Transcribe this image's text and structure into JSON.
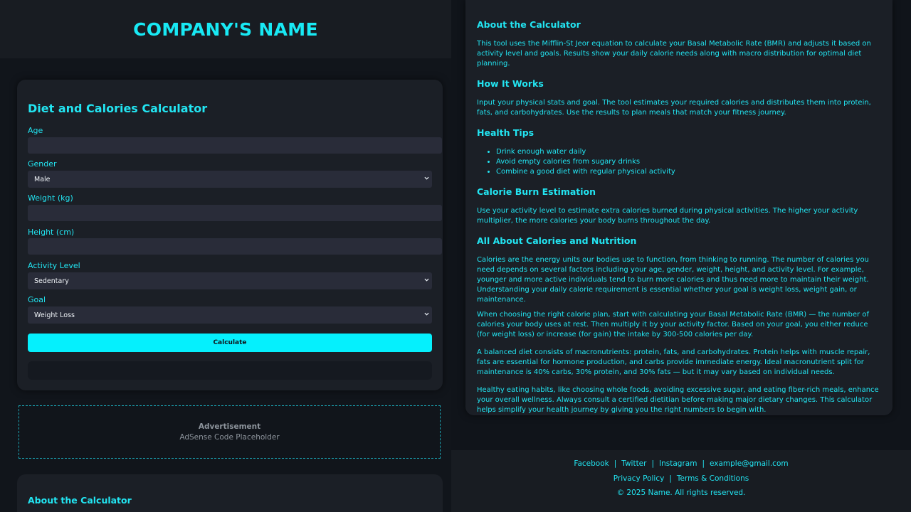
{
  "header": {
    "company_name": "COMPANY'S NAME"
  },
  "calculator": {
    "title": "Diet and Calories Calculator",
    "age_label": "Age",
    "age_value": "",
    "gender_label": "Gender",
    "gender_value": "Male",
    "weight_label": "Weight (kg)",
    "weight_value": "",
    "height_label": "Height (cm)",
    "height_value": "",
    "activity_label": "Activity Level",
    "activity_value": "Sedentary",
    "goal_label": "Goal",
    "goal_value": "Weight Loss",
    "calculate_label": "Calculate",
    "result_text": ""
  },
  "ad": {
    "title": "Advertisement",
    "placeholder": "AdSense Code Placeholder"
  },
  "about_left": {
    "title": "About the Calculator"
  },
  "info": {
    "about_title": "About the Calculator",
    "about_text": "This tool uses the Mifflin-St Jeor equation to calculate your Basal Metabolic Rate (BMR) and adjusts it based on activity level and goals. Results show your daily calorie needs along with macro distribution for optimal diet planning.",
    "how_title": "How It Works",
    "how_text": "Input your physical stats and goal. The tool estimates your required calories and distributes them into protein, fats, and carbohydrates. Use the results to plan meals that match your fitness journey.",
    "tips_title": "Health Tips",
    "tips": [
      "Drink enough water daily",
      "Avoid empty calories from sugary drinks",
      "Combine a good diet with regular physical activity"
    ],
    "burn_title": "Calorie Burn Estimation",
    "burn_text": "Use your activity level to estimate extra calories burned during physical activities. The higher your activity multiplier, the more calories your body burns throughout the day.",
    "nutrition_title": "All About Calories and Nutrition",
    "nutrition_p1": "Calories are the energy units our bodies use to function, from thinking to running. The number of calories you need depends on several factors including your age, gender, weight, height, and activity level. For example, younger and more active individuals tend to burn more calories and thus need more to maintain their weight. Understanding your daily calorie requirement is essential whether your goal is weight loss, weight gain, or maintenance.",
    "nutrition_p2": "When choosing the right calorie plan, start with calculating your Basal Metabolic Rate (BMR) — the number of calories your body uses at rest. Then multiply it by your activity factor. Based on your goal, you either reduce (for weight loss) or increase (for gain) the intake by 300-500 calories per day.",
    "nutrition_p3": "A balanced diet consists of macronutrients: protein, fats, and carbohydrates. Protein helps with muscle repair, fats are essential for hormone production, and carbs provide immediate energy. Ideal macronutrient split for maintenance is 40% carbs, 30% protein, and 30% fats — but it may vary based on individual needs.",
    "nutrition_p4": "Healthy eating habits, like choosing whole foods, avoiding excessive sugar, and eating fiber-rich meals, enhance your overall wellness. Always consult a certified dietitian before making major dietary changes. This calculator helps simplify your health journey by giving you the right numbers to begin with."
  },
  "footer": {
    "facebook": "Facebook",
    "twitter": "Twitter",
    "instagram": "Instagram",
    "email": "example@gmail.com",
    "privacy": "Privacy Policy",
    "terms": "Terms & Conditions",
    "separator": "|",
    "copyright": "© 2025 Name. All rights reserved."
  }
}
